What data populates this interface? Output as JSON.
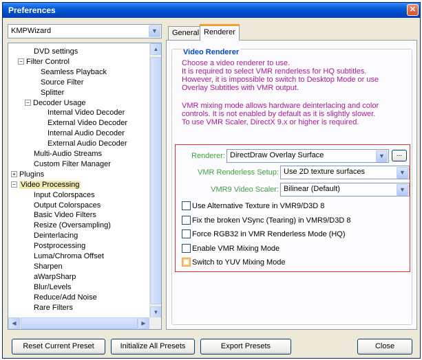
{
  "window": {
    "title": "Preferences",
    "close_glyph": "✕"
  },
  "preset": {
    "value": "KMPWizard"
  },
  "tree": {
    "items": [
      {
        "label": "DVD settings",
        "indent": 2
      },
      {
        "label": "Filter Control",
        "indent": 1,
        "expander": "−"
      },
      {
        "label": "Seamless Playback",
        "indent": 3
      },
      {
        "label": "Source Filter",
        "indent": 3
      },
      {
        "label": "Splitter",
        "indent": 3
      },
      {
        "label": "Decoder Usage",
        "indent": 2,
        "expander": "−"
      },
      {
        "label": "Internal Video Decoder",
        "indent": 4
      },
      {
        "label": "External Video Decoder",
        "indent": 4
      },
      {
        "label": "Internal Audio Decoder",
        "indent": 4
      },
      {
        "label": "External Audio Decoder",
        "indent": 4
      },
      {
        "label": "Multi-Audio Streams",
        "indent": 2
      },
      {
        "label": "Custom Filter Manager",
        "indent": 2
      },
      {
        "label": "Plugins",
        "indent": 0,
        "expander": "+"
      },
      {
        "label": "Video Processing",
        "indent": 0,
        "expander": "−",
        "selected": true
      },
      {
        "label": "Input Colorspaces",
        "indent": 2
      },
      {
        "label": "Output Colorspaces",
        "indent": 2
      },
      {
        "label": "Basic Video Filters",
        "indent": 2
      },
      {
        "label": "Resize (Oversampling)",
        "indent": 2
      },
      {
        "label": "Deinterlacing",
        "indent": 2
      },
      {
        "label": "Postprocessing",
        "indent": 2
      },
      {
        "label": "Luma/Chroma Offset",
        "indent": 2
      },
      {
        "label": "Sharpen",
        "indent": 2
      },
      {
        "label": "aWarpSharp",
        "indent": 2
      },
      {
        "label": "Blur/Levels",
        "indent": 2
      },
      {
        "label": "Reduce/Add Noise",
        "indent": 2
      },
      {
        "label": "Rare Filters",
        "indent": 2
      }
    ]
  },
  "tabs": {
    "general": "General",
    "renderer": "Renderer"
  },
  "video_renderer": {
    "title": "Video Renderer",
    "desc1": [
      "Choose a video renderer to use.",
      "It is required to select VMR renderless for HQ subtitles.",
      "However, it is impossible to switch to Desktop Mode or use",
      "Overlay Subtitles with VMR output."
    ],
    "desc2": [
      "VMR mixing mode allows hardware deinterlacing and color",
      "controls. It is not enabled by default as it is slightly slower.",
      "To use VMR Scaler, DirectX 9.x or higher is required."
    ],
    "renderer_label": "Renderer:",
    "renderer_value": "DirectDraw Overlay Surface",
    "dots_label": "...",
    "renderless_label": "VMR Renderless Setup:",
    "renderless_value": "Use 2D texture surfaces",
    "scaler_label": "VMR9 Video Scaler:",
    "scaler_value": "Bilinear (Default)",
    "options": [
      {
        "label": "Use Alternative Texture in VMR9/D3D 8",
        "checked": false
      },
      {
        "label": "Fix the broken VSync (Tearing) in VMR9/D3D 8",
        "checked": false
      },
      {
        "label": "Force RGB32 in VMR Renderless Mode (HQ)",
        "checked": false
      },
      {
        "label": "Enable VMR Mixing Mode",
        "checked": false
      },
      {
        "label": "Switch to YUV Mixing Mode",
        "checked": false,
        "hover": true
      }
    ]
  },
  "buttons": {
    "reset": "Reset Current Preset",
    "initialize": "Initialize All Presets",
    "export": "Export Presets",
    "close": "Close"
  },
  "icons": {
    "dropdown": "chevron-down-icon",
    "scroll_up": "arrow-up-icon",
    "scroll_down": "arrow-down-icon",
    "scroll_left": "arrow-left-icon",
    "scroll_right": "arrow-right-icon"
  },
  "colors": {
    "title_bar": "#0a5fd8",
    "group_title": "#0046d5",
    "description": "#b0179a",
    "field_label": "#3fa13f",
    "highlight_frame": "#e03030"
  }
}
